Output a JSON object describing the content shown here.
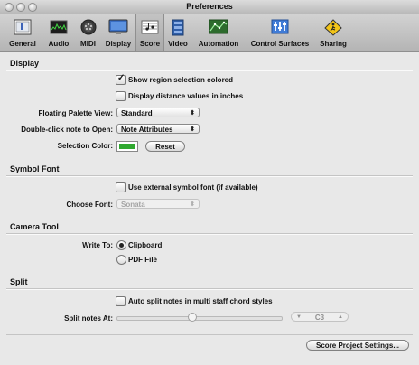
{
  "window": {
    "title": "Preferences"
  },
  "toolbar": {
    "items": [
      {
        "label": "General",
        "icon": "general-icon"
      },
      {
        "label": "Audio",
        "icon": "audio-icon"
      },
      {
        "label": "MIDI",
        "icon": "midi-icon"
      },
      {
        "label": "Display",
        "icon": "display-icon"
      },
      {
        "label": "Score",
        "icon": "score-icon",
        "selected": true
      },
      {
        "label": "Video",
        "icon": "video-icon"
      },
      {
        "label": "Automation",
        "icon": "automation-icon"
      },
      {
        "label": "Control Surfaces",
        "icon": "control-surfaces-icon"
      },
      {
        "label": "Sharing",
        "icon": "sharing-icon"
      }
    ]
  },
  "display": {
    "header": "Display",
    "show_region_selection": {
      "label": "Show region selection colored",
      "checked": true
    },
    "distance_inches": {
      "label": "Display distance values in inches",
      "checked": false
    },
    "floating_palette": {
      "label": "Floating Palette View:",
      "value": "Standard"
    },
    "double_click": {
      "label": "Double-click note to Open:",
      "value": "Note Attributes"
    },
    "selection_color": {
      "label": "Selection Color:",
      "color": "#2fa82f",
      "reset": "Reset"
    }
  },
  "symbol_font": {
    "header": "Symbol Font",
    "use_external": {
      "label": "Use external symbol font (if available)",
      "checked": false
    },
    "choose_font": {
      "label": "Choose Font:",
      "value": "Sonata"
    }
  },
  "camera_tool": {
    "header": "Camera Tool",
    "write_to": {
      "label": "Write To:",
      "options": [
        "Clipboard",
        "PDF File"
      ],
      "selected": "Clipboard"
    }
  },
  "split": {
    "header": "Split",
    "auto_split": {
      "label": "Auto split notes in multi staff chord styles",
      "checked": false
    },
    "split_at": {
      "label": "Split notes At:",
      "value": "C3",
      "slider_fraction": 0.46
    }
  },
  "footer": {
    "score_project_settings": "Score Project Settings..."
  },
  "colors": {
    "selection": "#2fa82f"
  }
}
